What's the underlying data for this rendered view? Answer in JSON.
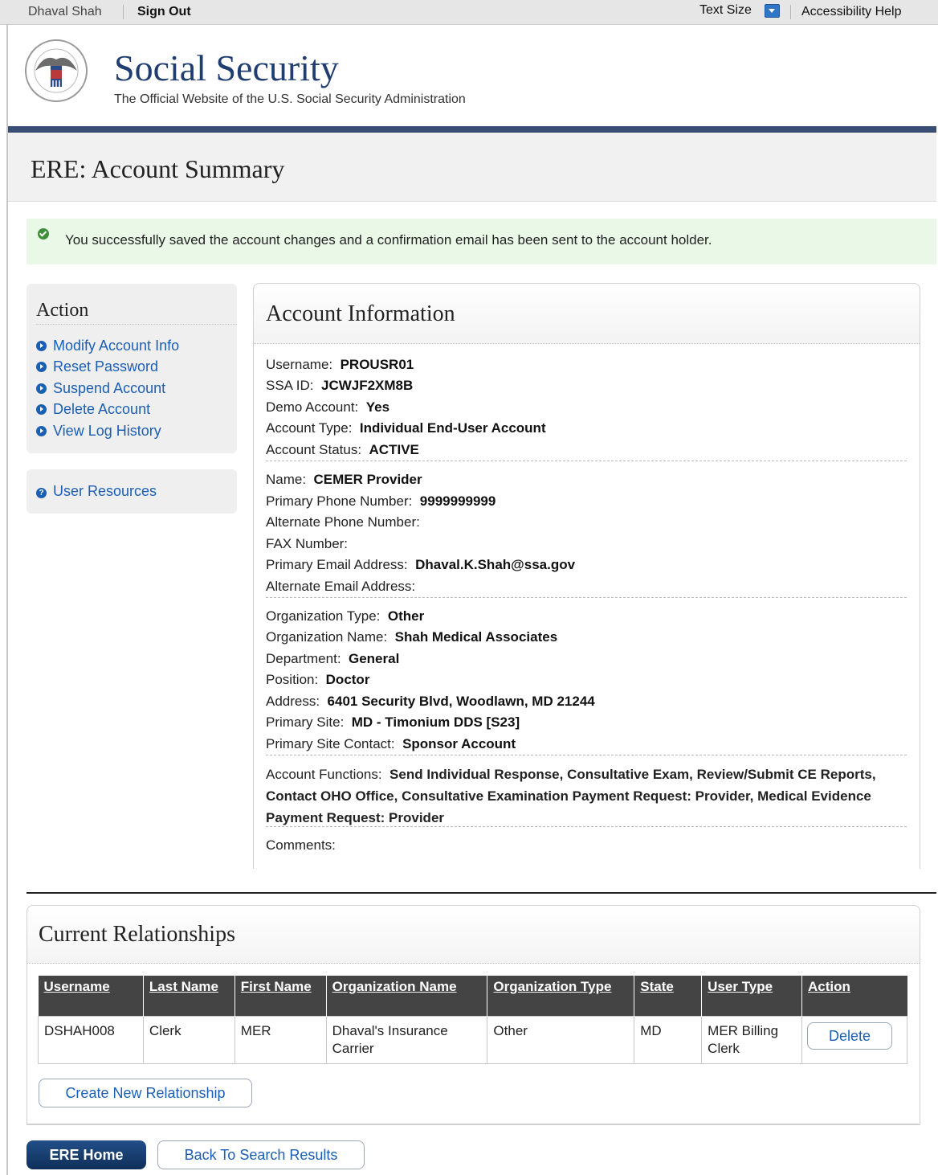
{
  "topbar": {
    "user_name": "Dhaval Shah",
    "sign_out": "Sign Out",
    "text_size": "Text Size",
    "accessibility_help": "Accessibility Help"
  },
  "site": {
    "title": "Social Security",
    "subtitle": "The Official Website of the U.S. Social Security Administration"
  },
  "page": {
    "title": "ERE: Account Summary"
  },
  "success_message": "You successfully saved the account changes and a confirmation email has been sent to the account holder.",
  "action_panel": {
    "heading": "Action",
    "links": [
      "Modify Account Info",
      "Reset Password",
      "Suspend Account",
      "Delete Account",
      "View Log History"
    ],
    "user_resources": "User Resources"
  },
  "account_info": {
    "heading": "Account Information",
    "username": {
      "label": "Username:",
      "value": "PROUSR01"
    },
    "ssa_id": {
      "label": "SSA ID:",
      "value": "JCWJF2XM8B"
    },
    "demo_account": {
      "label": "Demo Account:",
      "value": "Yes"
    },
    "account_type": {
      "label": "Account Type:",
      "value": "Individual End-User Account"
    },
    "account_status": {
      "label": "Account Status:",
      "value": "ACTIVE"
    },
    "name": {
      "label": "Name:",
      "value": "CEMER Provider"
    },
    "primary_phone": {
      "label": "Primary Phone Number:",
      "value": "9999999999"
    },
    "alternate_phone": {
      "label": "Alternate Phone Number:",
      "value": ""
    },
    "fax": {
      "label": "FAX Number:",
      "value": ""
    },
    "primary_email": {
      "label": "Primary Email Address:",
      "value": "Dhaval.K.Shah@ssa.gov"
    },
    "alternate_email": {
      "label": "Alternate Email Address:",
      "value": ""
    },
    "org_type": {
      "label": "Organization Type:",
      "value": "Other"
    },
    "org_name": {
      "label": "Organization Name:",
      "value": "Shah Medical Associates"
    },
    "department": {
      "label": "Department:",
      "value": "General"
    },
    "position": {
      "label": "Position:",
      "value": "Doctor"
    },
    "address": {
      "label": "Address:",
      "value": "6401 Security Blvd, Woodlawn, MD 21244"
    },
    "primary_site": {
      "label": "Primary Site:",
      "value": "MD - Timonium DDS [S23]"
    },
    "primary_site_contact": {
      "label": "Primary Site Contact:",
      "value": "Sponsor Account"
    },
    "account_functions": {
      "label": "Account Functions:",
      "value": "Send Individual Response, Consultative Exam, Review/Submit CE Reports, Contact OHO Office, Consultative Examination Payment Request: Provider, Medical Evidence Payment Request: Provider"
    },
    "comments": {
      "label": "Comments:",
      "value": ""
    }
  },
  "relationships": {
    "heading": "Current Relationships",
    "columns": [
      "Username",
      "Last Name",
      "First Name",
      "Organization Name",
      "Organization Type",
      "State",
      "User Type",
      "Action"
    ],
    "rows": [
      {
        "username": "DSHAH008",
        "last_name": "Clerk",
        "first_name": "MER",
        "org_name": "Dhaval's Insurance Carrier",
        "org_type": "Other",
        "state": "MD",
        "user_type": "MER Billing Clerk",
        "action": "Delete"
      }
    ],
    "create_button": "Create New Relationship"
  },
  "footer": {
    "home_button": "ERE Home",
    "back_button": "Back To Search Results"
  },
  "colors": {
    "brand_navy": "#1f3d6e",
    "link_blue": "#1b5fb4",
    "success_bg": "#eaf8e8"
  }
}
